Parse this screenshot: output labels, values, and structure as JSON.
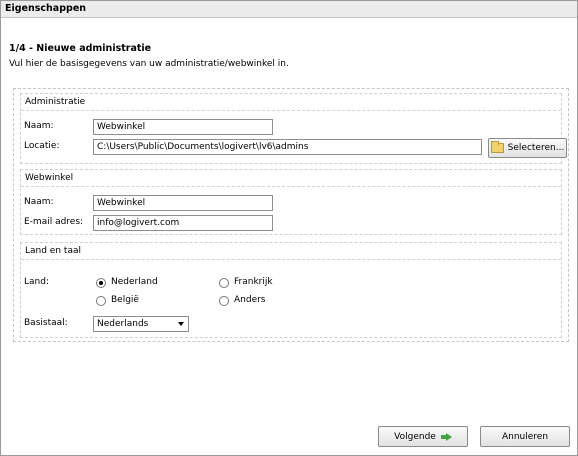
{
  "window": {
    "title": "Eigenschappen"
  },
  "page": {
    "heading": "1/4 - Nieuwe administratie",
    "description": "Vul hier de basisgegevens van uw administratie/webwinkel in."
  },
  "administratie": {
    "title": "Administratie",
    "naam_label": "Naam:",
    "naam_value": "Webwinkel",
    "locatie_label": "Locatie:",
    "locatie_value": "C:\\Users\\Public\\Documents\\logivert\\lv6\\admins",
    "select_button": "Selecteren..."
  },
  "webwinkel": {
    "title": "Webwinkel",
    "naam_label": "Naam:",
    "naam_value": "Webwinkel",
    "email_label": "E-mail adres:",
    "email_value": "info@logivert.com"
  },
  "land_taal": {
    "title": "Land en taal",
    "land_label": "Land:",
    "options": [
      {
        "label": "Nederland",
        "selected": true
      },
      {
        "label": "België",
        "selected": false
      },
      {
        "label": "Frankrijk",
        "selected": false
      },
      {
        "label": "Anders",
        "selected": false
      }
    ],
    "basistaal_label": "Basistaal:",
    "basistaal_value": "Nederlands"
  },
  "footer": {
    "next_button": "Volgende",
    "cancel_button": "Annuleren"
  },
  "icons": {
    "folder": "folder-icon",
    "next": "arrow-right-icon",
    "dropdown": "chevron-down-icon"
  }
}
